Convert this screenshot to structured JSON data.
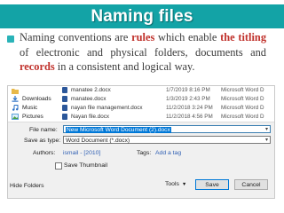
{
  "slide": {
    "title": "Naming files",
    "bullet": {
      "p1": "Naming conventions are ",
      "h1": "rules",
      "p2": " which enable ",
      "h2": "the titling",
      "p3": " of electronic and physical folders, documents and ",
      "h3": "records",
      "p4": " in a consistent and logical way."
    }
  },
  "colors": {
    "banner": "#13a3a6",
    "highlight": "#c0312b",
    "bullet": "#2ab3b8"
  },
  "dialog": {
    "nav": [
      {
        "label": "",
        "icon": "folder-icon"
      },
      {
        "label": "Downloads",
        "icon": "download-icon"
      },
      {
        "label": "Music",
        "icon": "music-icon"
      },
      {
        "label": "Pictures",
        "icon": "pictures-icon"
      }
    ],
    "files": [
      {
        "name": "manatee 2.docx",
        "date": "1/7/2019 8:16 PM",
        "type": "Microsoft Word D"
      },
      {
        "name": "manatee.docx",
        "date": "1/3/2019 2:43 PM",
        "type": "Microsoft Word D"
      },
      {
        "name": "nayan file management.docx",
        "date": "11/2/2018 3:24 PM",
        "type": "Microsoft Word D"
      },
      {
        "name": "Nayan file.docx",
        "date": "11/2/2018 4:56 PM",
        "type": "Microsoft Word D"
      }
    ],
    "file_name_label": "File name:",
    "file_name_value": "New Microsoft Word Document (2).docx",
    "save_type_label": "Save as type:",
    "save_type_value": "Word Document (*.docx)",
    "authors_label": "Authors:",
    "authors_value": "ismail - [2010]",
    "tags_label": "Tags:",
    "tags_value": "Add a tag",
    "thumbnail_label": "Save Thumbnail",
    "hide_folders_label": "Hide Folders",
    "tools_label": "Tools",
    "save_label": "Save",
    "cancel_label": "Cancel"
  }
}
